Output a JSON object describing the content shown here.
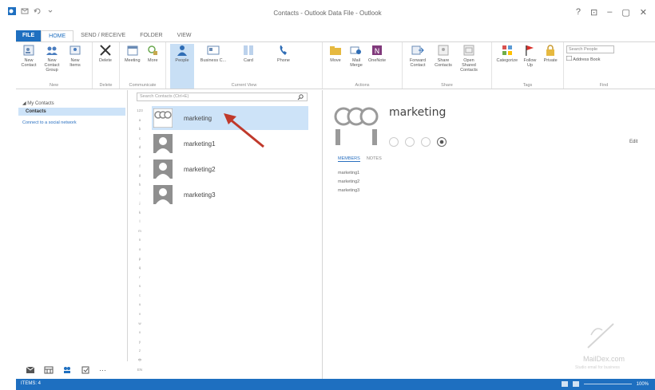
{
  "window": {
    "title": "Contacts - Outlook Data File - Outlook",
    "controls": [
      "?",
      "⊡",
      "–",
      "▢",
      "✕"
    ]
  },
  "tabs": [
    {
      "label": "FILE",
      "kind": "file"
    },
    {
      "label": "HOME",
      "kind": "active"
    },
    {
      "label": "SEND / RECEIVE",
      "kind": ""
    },
    {
      "label": "FOLDER",
      "kind": ""
    },
    {
      "label": "VIEW",
      "kind": ""
    }
  ],
  "ribbon": {
    "groups": {
      "new": "New",
      "delete": "Delete",
      "communicate": "Communicate",
      "current_view": "Current View",
      "actions": "Actions",
      "share": "Share",
      "tags": "Tags",
      "find": "Find"
    },
    "buttons": {
      "new_contact": "New Contact",
      "new_contact_group": "New Contact Group",
      "new_items": "New Items",
      "delete": "Delete",
      "meeting": "Meeting",
      "more": "More",
      "people": "People",
      "business_card": "Business C...",
      "card": "Card",
      "phone": "Phone",
      "move": "Move",
      "mail_merge": "Mail Merge",
      "onenote": "OneNote",
      "forward_contact": "Forward Contact",
      "share_contacts": "Share Contacts",
      "open_shared_contacts": "Open Shared Contacts",
      "categorize": "Categorize",
      "follow_up": "Follow Up",
      "private": "Private"
    },
    "search_people_placeholder": "Search People",
    "address_book": "Address Book"
  },
  "nav": {
    "my_contacts": "◢ My Contacts",
    "contacts": "Contacts",
    "connect": "Connect to a social network",
    "more": "···"
  },
  "search": {
    "placeholder": "Search Contacts (Ctrl+E)"
  },
  "alphabet": [
    "123",
    "a",
    "b",
    "c",
    "d",
    "e",
    "f",
    "g",
    "h",
    "i",
    "j",
    "k",
    "l",
    "m",
    "n",
    "o",
    "p",
    "q",
    "r",
    "s",
    "t",
    "u",
    "v",
    "w",
    "x",
    "y",
    "z",
    "中",
    "EN"
  ],
  "contacts": [
    {
      "name": "marketing",
      "selected": true
    },
    {
      "name": "marketing1",
      "selected": false
    },
    {
      "name": "marketing2",
      "selected": false
    },
    {
      "name": "marketing3",
      "selected": false
    }
  ],
  "detail": {
    "name": "marketing",
    "edit": "Edit",
    "tab_members": "MEMBERS",
    "tab_notes": "NOTES",
    "members": [
      "marketing1",
      "marketing2",
      "marketing3"
    ]
  },
  "watermark": {
    "text": "MailDex.com",
    "sub": "Studio email for business"
  },
  "status": {
    "items": "ITEMS: 4",
    "zoom": "100%"
  },
  "colors": {
    "accent": "#1e6fc0",
    "selection": "#cde3f8",
    "arrow": "#c0392b"
  }
}
